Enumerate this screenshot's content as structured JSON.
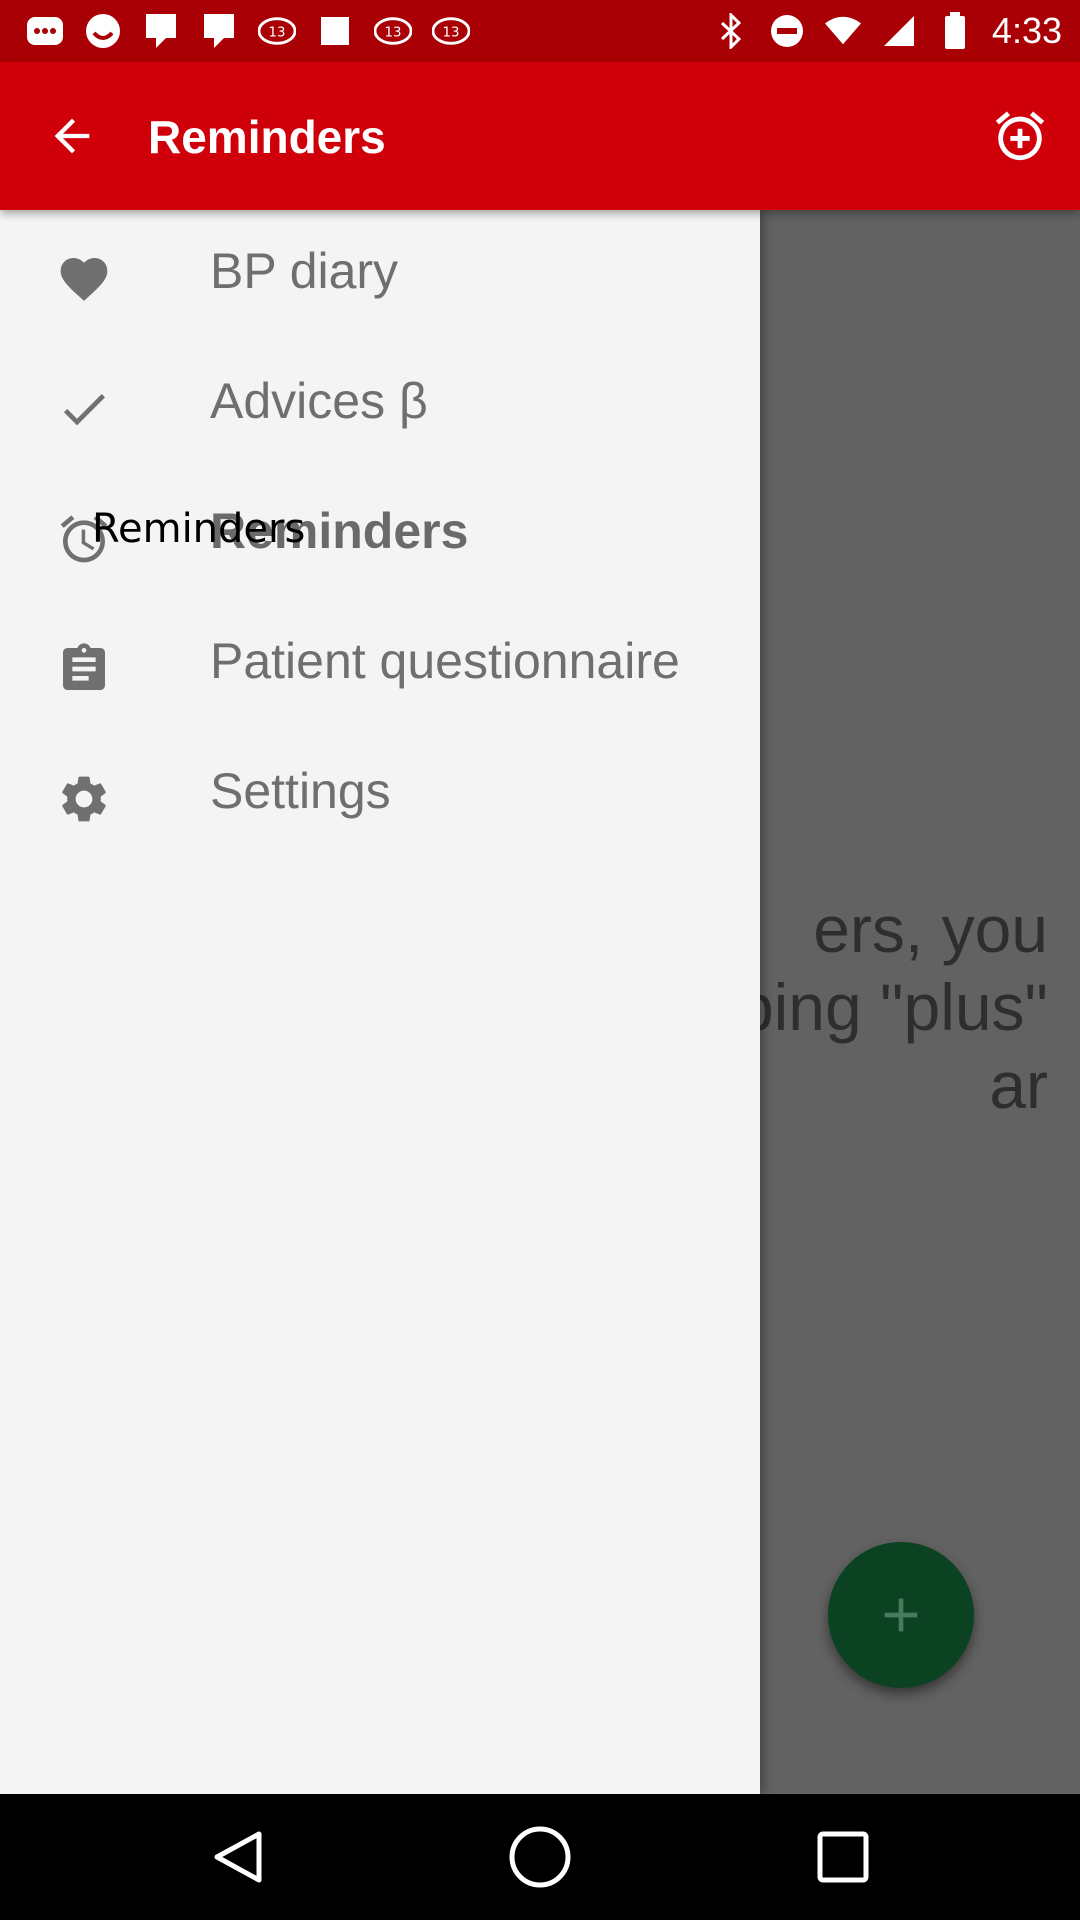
{
  "status_bar": {
    "time": "4:33",
    "left_icons": [
      "messaging-icon",
      "face-icon",
      "fb-icon",
      "fb-icon",
      "abc13-icon",
      "message-icon",
      "abc13-icon",
      "abc13-icon",
      "bluetooth-icon",
      "dnd-icon",
      "wifi-icon",
      "signal-icon",
      "battery-icon"
    ]
  },
  "app_bar": {
    "title": "Reminders",
    "back_icon": "arrow-back-icon",
    "action_icon": "alarm-add-icon"
  },
  "drawer": {
    "items": [
      {
        "label": "BP diary",
        "icon": "heart-icon"
      },
      {
        "label": "Advices β",
        "icon": "check-icon"
      },
      {
        "label": "Reminders",
        "icon": "alarm-icon",
        "active": true
      },
      {
        "label": "Patient questionnaire",
        "icon": "clipboard-icon"
      },
      {
        "label": "Settings",
        "icon": "gear-icon"
      }
    ],
    "tooltip": "Reminders"
  },
  "content": {
    "partial_message_lines": [
      "ers, you",
      "ping \"plus\"",
      "ar"
    ],
    "fab_icon": "plus-icon"
  },
  "colors": {
    "status_bar": "#a80004",
    "app_bar": "#d0000b",
    "drawer_bg": "#f4f4f4",
    "scrim": "#626262",
    "fab": "#0b4222"
  },
  "nav_bar": {
    "buttons": [
      "back-triangle-icon",
      "home-circle-icon",
      "recents-square-icon"
    ]
  }
}
